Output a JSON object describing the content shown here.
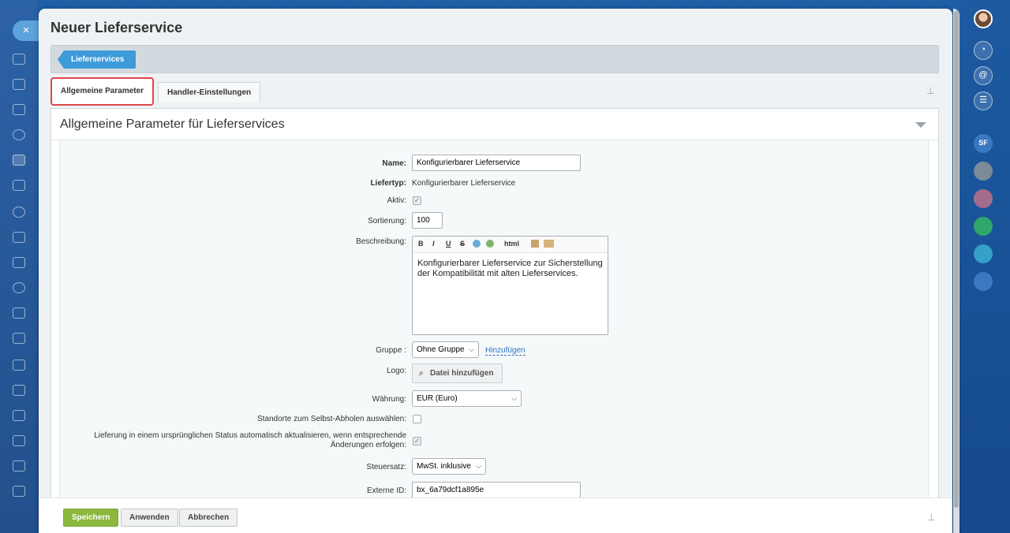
{
  "window": {
    "title": "Neuer Lieferservice",
    "close_label": "×"
  },
  "breadcrumb": {
    "items": [
      "Lieferservices"
    ]
  },
  "tabs": [
    {
      "label": "Allgemeine Parameter",
      "active": true
    },
    {
      "label": "Handler-Einstellungen",
      "active": false
    }
  ],
  "section": {
    "title": "Allgemeine Parameter für Lieferservices"
  },
  "form": {
    "name_label": "Name:",
    "name_value": "Konfigurierbarer Lieferservice",
    "type_label": "Liefertyp:",
    "type_value": "Konfigurierbarer Lieferservice",
    "active_label": "Aktiv:",
    "active_checked": true,
    "sort_label": "Sortierung:",
    "sort_value": "100",
    "desc_label": "Beschreibung:",
    "desc_toolbar": [
      "B",
      "I",
      "U",
      "S",
      "html"
    ],
    "desc_value": "Konfigurierbarer Lieferservice zur Sicherstellung der Kompatibilität mit alten Lieferservices.",
    "group_label": "Gruppe :",
    "group_value": "Ohne Gruppe",
    "group_add_link": "Hinzufügen",
    "logo_label": "Logo:",
    "logo_button": "Datei hinzufügen",
    "currency_label": "Währung:",
    "currency_value": "EUR (Euro)",
    "pickup_label": "Standorte zum Selbst-Abholen auswählen:",
    "pickup_checked": false,
    "autoupdate_label_1": "Lieferung in einem ursprünglichen Status automatisch aktualisieren, wenn entsprechende",
    "autoupdate_label_2": "Änderungen erfolgen:",
    "autoupdate_checked": true,
    "tax_label": "Steuersatz:",
    "tax_value": "MwSt. inklusive",
    "extid_label": "Externe ID:",
    "extid_value": "bx_6a79dcf1a895e"
  },
  "footer": {
    "save_label": "Speichern",
    "apply_label": "Anwenden",
    "cancel_label": "Abbrechen"
  },
  "right_rail": {
    "initials": "SF"
  },
  "colors": {
    "accent": "#3d9bd8",
    "primary_button": "#8bb83c",
    "tab_highlight": "#e0434b",
    "link": "#2a73c6"
  }
}
